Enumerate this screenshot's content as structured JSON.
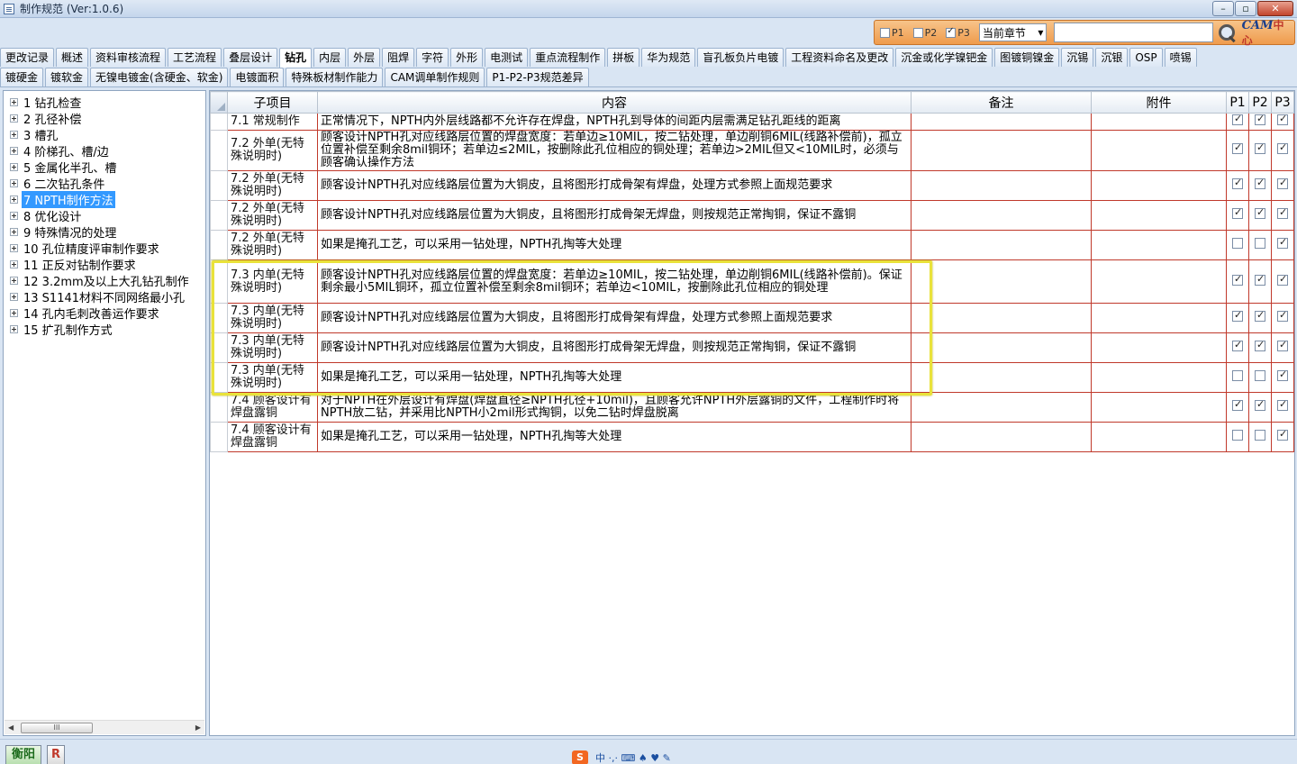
{
  "window": {
    "title": "制作规范 (Ver:1.0.6)",
    "minimize": "–",
    "maximize": "▫",
    "close": "✕"
  },
  "search": {
    "p1_label": "P1",
    "p2_label": "P2",
    "p3_label": "P3",
    "scope": "当前章节",
    "logo": "CAM",
    "logo_suffix": "中心"
  },
  "tabs_row1": [
    "更改记录",
    "概述",
    "资料审核流程",
    "工艺流程",
    "叠层设计",
    "钻孔",
    "内层",
    "外层",
    "阻焊",
    "字符",
    "外形",
    "电测试",
    "重点流程制作",
    "拼板",
    "华为规范",
    "盲孔板负片电镀",
    "工程资料命名及更改",
    "沉金或化学镍钯金",
    "图镀铜镍金",
    "沉锡",
    "沉银",
    "OSP",
    "喷锡"
  ],
  "tabs_row2": [
    "镀硬金",
    "镀软金",
    "无镍电镀金(含硬金、软金)",
    "电镀面积",
    "特殊板材制作能力",
    "CAM调单制作规则",
    "P1-P2-P3规范差异"
  ],
  "tree": [
    "1 钻孔检查",
    "2 孔径补偿",
    "3 槽孔",
    "4 阶梯孔、槽/边",
    "5 金属化半孔、槽",
    "6 二次钻孔条件",
    "7 NPTH制作方法",
    "8 优化设计",
    "9 特殊情况的处理",
    "10 孔位精度评审制作要求",
    "11 正反对钻制作要求",
    "12 3.2mm及以上大孔钻孔制作",
    "13 S1141材料不同网络最小孔",
    "14 孔内毛刺改善运作要求",
    "15 扩孔制作方式"
  ],
  "tree_selected_label": "7 NPTH制作方法",
  "tree_scroll_thumb": "III",
  "grid": {
    "headers": {
      "sub": "子项目",
      "content": "内容",
      "note": "备注",
      "attach": "附件",
      "p1": "P1",
      "p2": "P2",
      "p3": "P3"
    },
    "rows": [
      {
        "sub": "7.1 常规制作",
        "content": "正常情况下，NPTH内外层线路都不允许存在焊盘，NPTH孔到导体的间距内层需满足钻孔距线的距离",
        "p1": true,
        "p2": true,
        "p3": true
      },
      {
        "sub": "7.2 外单(无特殊说明时)",
        "content": "顾客设计NPTH孔对应线路层位置的焊盘宽度：若单边≥10MIL，按二钻处理，单边削铜6MIL(线路补偿前)，孤立位置补偿至剩余8mil铜环；若单边≤2MIL，按删除此孔位相应的铜处理；若单边>2MIL但又<10MIL时，必须与顾客确认操作方法",
        "p1": true,
        "p2": true,
        "p3": true
      },
      {
        "sub": "7.2 外单(无特殊说明时)",
        "content": "顾客设计NPTH孔对应线路层位置为大铜皮，且将图形打成骨架有焊盘，处理方式参照上面规范要求",
        "p1": true,
        "p2": true,
        "p3": true
      },
      {
        "sub": "7.2 外单(无特殊说明时)",
        "content": "顾客设计NPTH孔对应线路层位置为大铜皮，且将图形打成骨架无焊盘，则按规范正常掏铜，保证不露铜",
        "p1": true,
        "p2": true,
        "p3": true
      },
      {
        "sub": "7.2 外单(无特殊说明时)",
        "content": "如果是掩孔工艺，可以采用一钻处理，NPTH孔掏等大处理",
        "p1": false,
        "p2": false,
        "p3": true
      },
      {
        "sub": "7.3 内单(无特殊说明时)",
        "content": "顾客设计NPTH孔对应线路层位置的焊盘宽度：若单边≥10MIL，按二钻处理，单边削铜6MIL(线路补偿前)。保证剩余最小5MIL铜环，孤立位置补偿至剩余8mil铜环；若单边<10MIL，按删除此孔位相应的铜处理",
        "p1": true,
        "p2": true,
        "p3": true
      },
      {
        "sub": "7.3 内单(无特殊说明时)",
        "content": "顾客设计NPTH孔对应线路层位置为大铜皮，且将图形打成骨架有焊盘，处理方式参照上面规范要求",
        "p1": true,
        "p2": true,
        "p3": true
      },
      {
        "sub": "7.3 内单(无特殊说明时)",
        "content": "顾客设计NPTH孔对应线路层位置为大铜皮，且将图形打成骨架无焊盘，则按规范正常掏铜，保证不露铜",
        "p1": true,
        "p2": true,
        "p3": true
      },
      {
        "sub": "7.3 内单(无特殊说明时)",
        "content": "如果是掩孔工艺，可以采用一钻处理，NPTH孔掏等大处理",
        "p1": false,
        "p2": false,
        "p3": true
      },
      {
        "sub": "7.4 顾客设计有焊盘露铜",
        "content": "对于NPTH在外层设计有焊盘(焊盘直径≥NPTH孔径+10mil)，且顾客允许NPTH外层露铜的文件，工程制作时将NPTH放二钻，并采用比NPTH小2mil形式掏铜，以免二钻时焊盘脱离",
        "p1": true,
        "p2": true,
        "p3": true
      },
      {
        "sub": "7.4 顾客设计有焊盘露铜",
        "content": "如果是掩孔工艺，可以采用一钻处理，NPTH孔掏等大处理",
        "p1": false,
        "p2": false,
        "p3": true
      }
    ]
  },
  "status": {
    "btn_a": "衡阳",
    "btn_b": "R",
    "ime_s": "S",
    "ime_text": "中 ·,· ⌨ ♠ ♥ ✎"
  },
  "colors": {
    "grid_border": "#c0392b",
    "highlight": "#e9e23a",
    "selection": "#3399ff"
  }
}
